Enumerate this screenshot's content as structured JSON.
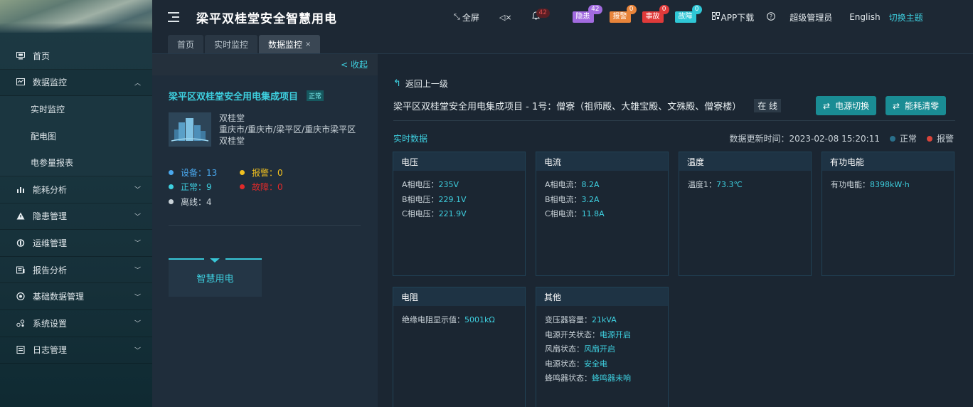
{
  "app": {
    "title": "梁平双桂堂安全智慧用电"
  },
  "sidebar": {
    "items": [
      {
        "label": "首页",
        "icon": "monitor-icon",
        "expanded": false
      },
      {
        "label": "数据监控",
        "icon": "data-monitor-icon",
        "expanded": true,
        "children": [
          {
            "label": "实时监控"
          },
          {
            "label": "配电图"
          },
          {
            "label": "电参量报表"
          }
        ]
      },
      {
        "label": "能耗分析",
        "icon": "bar-chart-icon"
      },
      {
        "label": "隐患管理",
        "icon": "warning-icon"
      },
      {
        "label": "运维管理",
        "icon": "maintenance-icon"
      },
      {
        "label": "报告分析",
        "icon": "report-icon"
      },
      {
        "label": "基础数据管理",
        "icon": "database-icon"
      },
      {
        "label": "系统设置",
        "icon": "settings-icon"
      },
      {
        "label": "日志管理",
        "icon": "log-icon"
      }
    ]
  },
  "topbar": {
    "fullscreen": "全屏",
    "mute_icon": "speaker-mute-icon",
    "bell_count": "42",
    "pills": [
      {
        "label": "隐患",
        "count": "42",
        "color": "#a26be0",
        "badge": "#a26be0"
      },
      {
        "label": "报警",
        "count": "0",
        "color": "#e8843a",
        "badge": "#e8843a"
      },
      {
        "label": "事故",
        "count": "0",
        "color": "#e03a3a",
        "badge": "#e03a3a"
      },
      {
        "label": "故障",
        "count": "0",
        "color": "#2fc7d6",
        "badge": "#2fc7d6"
      }
    ],
    "app_download": "APP下载",
    "help_icon": "help-icon",
    "user": "超级管理员",
    "language": "English",
    "theme": "切换主题"
  },
  "tabs": [
    {
      "label": "首页",
      "active": false
    },
    {
      "label": "实时监控",
      "active": false
    },
    {
      "label": "数据监控",
      "active": true,
      "close": "×"
    }
  ],
  "project": {
    "collapse": "< 收起",
    "name": "梁平区双桂堂安全用电集成项目",
    "status": "正常",
    "org": "双桂堂",
    "address": "重庆市/重庆市/梁平区/重庆市梁平区双桂堂",
    "stats": {
      "devices": "设备：13",
      "alarm": "报警：0",
      "normal": "正常：9",
      "fault": "故障：0",
      "offline": "离线：4"
    },
    "smart_button": "智慧用电"
  },
  "main": {
    "back": "返回上一级",
    "device_title": "梁平区双桂堂安全用电集成项目 - 1号：僧寮（祖师殿、大雄宝殿、文殊殿、僧寮楼）",
    "online": "在 线",
    "btn_switch": "电源切换",
    "btn_clear": "能耗清零",
    "realtime": "实时数据",
    "update_time": "数据更新时间：2023-02-08 15:20:11",
    "legend_normal": "正常",
    "legend_alarm": "报警",
    "colors": {
      "normal": "#2a6f8a",
      "alarm": "#d9443a",
      "accent": "#3ed0e0"
    }
  },
  "cards": {
    "voltage": {
      "title": "电压",
      "rows": [
        {
          "k": "A相电压：",
          "v": "235V"
        },
        {
          "k": "B相电压：",
          "v": "229.1V"
        },
        {
          "k": "C相电压：",
          "v": "221.9V"
        }
      ]
    },
    "current": {
      "title": "电流",
      "rows": [
        {
          "k": "A相电流：",
          "v": "8.2A"
        },
        {
          "k": "B相电流：",
          "v": "3.2A"
        },
        {
          "k": "C相电流：",
          "v": "11.8A"
        }
      ]
    },
    "temperature": {
      "title": "温度",
      "rows": [
        {
          "k": "温度1：",
          "v": "73.3℃"
        }
      ]
    },
    "energy": {
      "title": "有功电能",
      "rows": [
        {
          "k": "有功电能：",
          "v": "8398kW·h"
        }
      ]
    },
    "resistance": {
      "title": "电阻",
      "rows": [
        {
          "k": "绝缘电阻显示值：",
          "v": "5001kΩ"
        }
      ]
    },
    "other": {
      "title": "其他",
      "rows": [
        {
          "k": "变压器容量：",
          "v": "21kVA"
        },
        {
          "k": "电源开关状态：",
          "v": "电源开启"
        },
        {
          "k": "风扇状态：",
          "v": "风扇开启"
        },
        {
          "k": "电源状态：",
          "v": "安全电"
        },
        {
          "k": "蜂鸣器状态：",
          "v": "蜂鸣器未响"
        }
      ]
    }
  }
}
